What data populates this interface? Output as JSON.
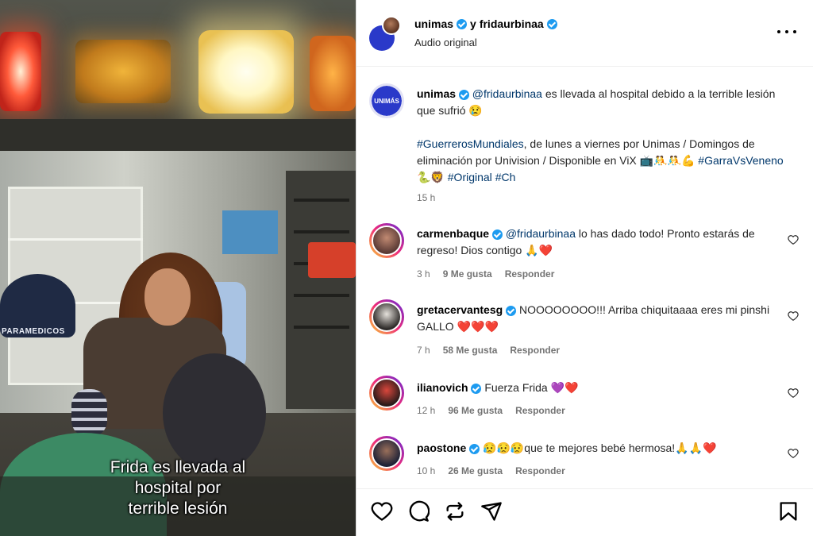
{
  "video": {
    "caption": "Frida es llevada al\nhospital por\nterrible lesión",
    "vest_label": "PARAMEDICOS"
  },
  "header": {
    "account1": "unimas",
    "connector": "y",
    "account2": "fridaurbinaa",
    "audio": "Audio original",
    "more_icon": "more-horizontal-icon"
  },
  "caption": {
    "username": "unimas",
    "mention": "@fridaurbinaa",
    "text1": " es llevada al hospital debido a la terrible lesión que sufrió 😢",
    "hashtag1": "#GuerrerosMundiales",
    "text2": ", de lunes a viernes por Unimas / Domingos de eliminación por Univision / Disponible en ViX 📺🤼🤼💪",
    "hashtag2": "#GarraVsVeneno",
    "emoji_mid": " 🐍🦁 ",
    "hashtag3": "#Original",
    "hashtag4": "#Ch",
    "time": "15 h",
    "avatar_label": "UNIMÁS"
  },
  "comments": [
    {
      "username": "carmenbaque",
      "mention": "@fridaurbinaa",
      "text": " lo has dado todo! Pronto estarás de regreso! Dios contigo 🙏❤️",
      "time": "3 h",
      "likes": "9 Me gusta",
      "reply": "Responder"
    },
    {
      "username": "gretacervantesg",
      "mention": "",
      "text": " NOOOOOOOO!!! Arriba chiquitaaaa eres mi pinshi GALLO ❤️❤️❤️",
      "time": "7 h",
      "likes": "58 Me gusta",
      "reply": "Responder"
    },
    {
      "username": "ilianovich",
      "mention": "",
      "text": " Fuerza Frida 💜❤️",
      "time": "12 h",
      "likes": "96 Me gusta",
      "reply": "Responder"
    },
    {
      "username": "paostone",
      "mention": "",
      "text": " 😥😥😥que te mejores bebé hermosa!🙏🙏❤️",
      "time": "10 h",
      "likes": "26 Me gusta",
      "reply": "Responder"
    }
  ],
  "actions": {
    "like": "heart-icon",
    "comment": "comment-icon",
    "share": "repost-icon",
    "send": "send-icon",
    "save": "bookmark-icon"
  },
  "colors": {
    "verified": "#1d9bf0",
    "link": "#00376b",
    "unimas_brand": "#2a39c9"
  }
}
